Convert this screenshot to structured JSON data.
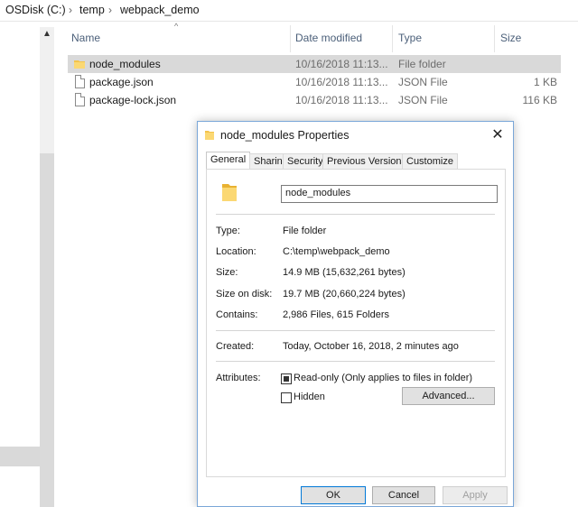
{
  "breadcrumb": [
    "OSDisk (C:)",
    "temp",
    "webpack_demo"
  ],
  "columns": {
    "name": "Name",
    "date": "Date modified",
    "type": "Type",
    "size": "Size"
  },
  "files": [
    {
      "name": "node_modules",
      "date": "10/16/2018 11:13...",
      "type": "File folder",
      "size": ""
    },
    {
      "name": "package.json",
      "date": "10/16/2018 11:13...",
      "type": "JSON File",
      "size": "1 KB"
    },
    {
      "name": "package-lock.json",
      "date": "10/16/2018 11:13...",
      "type": "JSON File",
      "size": "116 KB"
    }
  ],
  "dialog": {
    "title": "node_modules Properties",
    "close": "✕",
    "tabs": [
      "General",
      "Sharing",
      "Security",
      "Previous Versions",
      "Customize"
    ],
    "name_value": "node_modules",
    "props": [
      {
        "label": "Type:",
        "value": "File folder"
      },
      {
        "label": "Location:",
        "value": "C:\\temp\\webpack_demo"
      },
      {
        "label": "Size:",
        "value": "14.9 MB (15,632,261 bytes)"
      },
      {
        "label": "Size on disk:",
        "value": "19.7 MB (20,660,224 bytes)"
      },
      {
        "label": "Contains:",
        "value": "2,986 Files, 615 Folders"
      }
    ],
    "created_label": "Created:",
    "created_value": "Today, October 16, 2018, 2 minutes ago",
    "attributes_label": "Attributes:",
    "readonly_label": "Read-only (Only applies to files in folder)",
    "hidden_label": "Hidden",
    "advanced_button": "Advanced...",
    "ok_button": "OK",
    "cancel_button": "Cancel",
    "apply_button": "Apply"
  },
  "colors": {
    "folder": "#f3c34b",
    "accent": "#0078d7",
    "selected_row": "#d9d9d9"
  }
}
